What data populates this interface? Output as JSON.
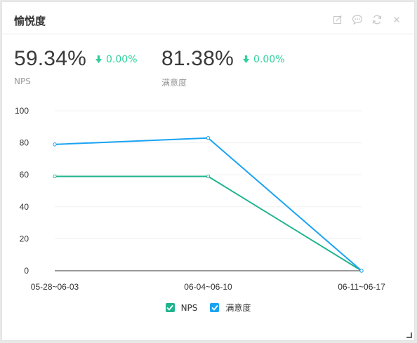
{
  "panel": {
    "title": "愉悦度",
    "toolbar": [
      "edit-icon",
      "comment-icon",
      "refresh-icon",
      "close-icon"
    ]
  },
  "metrics": [
    {
      "value": "59.34%",
      "delta": "0.00%",
      "label": "NPS"
    },
    {
      "value": "81.38%",
      "delta": "0.00%",
      "label": "满意度"
    }
  ],
  "colors": {
    "nps": "#20b48e",
    "satisfaction": "#1aa3f3",
    "delta": "#2fd19c"
  },
  "chart_data": {
    "type": "line",
    "categories": [
      "05-28~06-03",
      "06-04~06-10",
      "06-11~06-17"
    ],
    "series": [
      {
        "name": "NPS",
        "values": [
          59,
          59,
          0
        ]
      },
      {
        "name": "满意度",
        "values": [
          79,
          83,
          0
        ]
      }
    ],
    "ylim": [
      0,
      100
    ],
    "yticks": [
      0,
      20,
      40,
      60,
      80,
      100
    ],
    "grid": true,
    "legend": "bottom"
  }
}
